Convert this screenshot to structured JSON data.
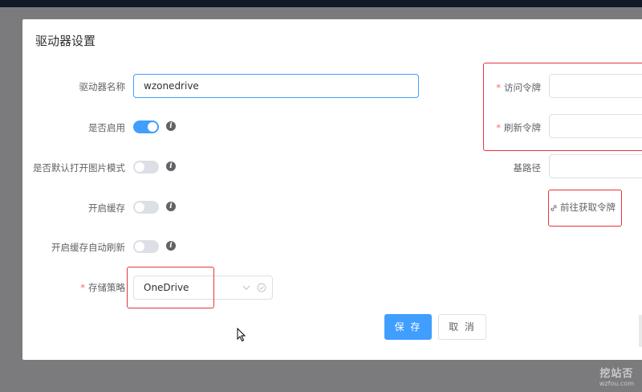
{
  "dialog": {
    "title": "驱动器设置"
  },
  "form": {
    "drive_name": {
      "label": "驱动器名称",
      "value": "wzonedrive"
    },
    "enabled": {
      "label": "是否启用",
      "on": true
    },
    "default_image_mode": {
      "label": "是否默认打开图片模式",
      "on": false
    },
    "cache": {
      "label": "开启缓存",
      "on": false
    },
    "cache_auto_refresh": {
      "label": "开启缓存自动刷新",
      "on": false
    },
    "storage": {
      "label": "存储策略",
      "value": "OneDrive",
      "required_mark": "*"
    },
    "access_token": {
      "label": "访问令牌",
      "value": "",
      "required_mark": "*"
    },
    "refresh_token": {
      "label": "刷新令牌",
      "value": "",
      "required_mark": "*"
    },
    "base_path": {
      "label": "基路径",
      "value": ""
    },
    "get_token_link": "前往获取令牌",
    "info_glyph": "i"
  },
  "buttons": {
    "save": "保 存",
    "cancel": "取 消"
  },
  "watermark": {
    "title": "挖站否",
    "subtitle": "wzfou.com"
  },
  "colors": {
    "primary": "#409eff",
    "highlight_box": "#e8343a",
    "required": "#f56c6c"
  }
}
